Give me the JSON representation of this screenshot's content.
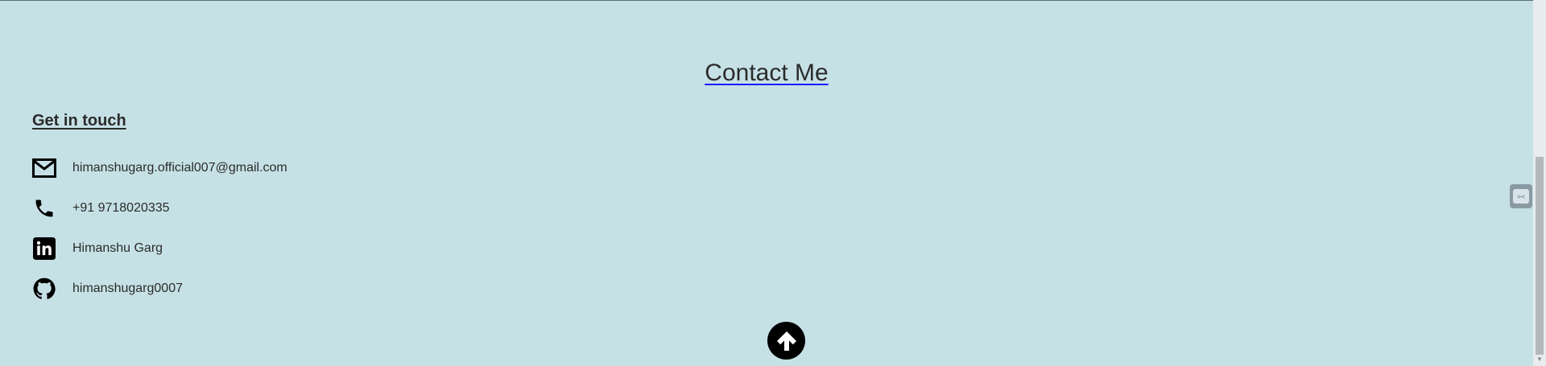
{
  "section": {
    "title": "Contact Me",
    "subtitle": "Get in touch"
  },
  "contacts": [
    {
      "icon": "mail-icon",
      "label": "himanshugarg.official007@gmail.com"
    },
    {
      "icon": "phone-icon",
      "label": "+91 9718020335"
    },
    {
      "icon": "linkedin-icon",
      "label": "Himanshu Garg"
    },
    {
      "icon": "github-icon",
      "label": "himanshugarg0007"
    }
  ],
  "colors": {
    "background": "#c6e1e6",
    "text": "#2b2b2b",
    "link_underline": "#1a1aff",
    "icon": "#000000"
  },
  "back_to_top": {
    "icon": "arrow-up-icon"
  }
}
